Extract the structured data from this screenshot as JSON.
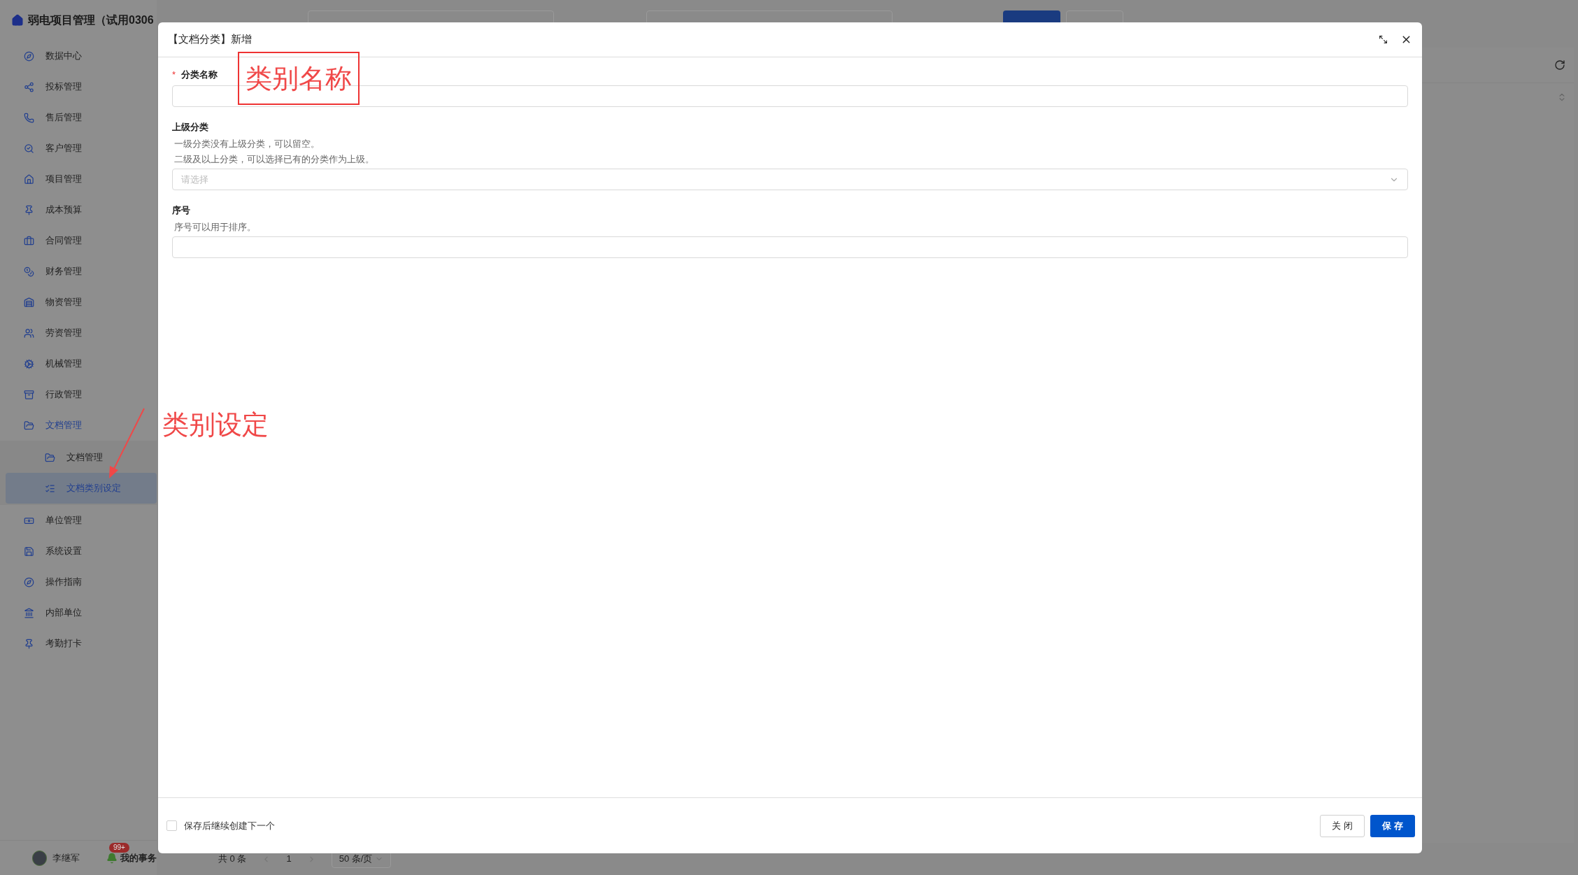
{
  "app_title": "弱电项目管理（试用0306",
  "sidebar": {
    "items": [
      {
        "label": "数据中心",
        "selected": false
      },
      {
        "label": "投标管理",
        "selected": false
      },
      {
        "label": "售后管理",
        "selected": false
      },
      {
        "label": "客户管理",
        "selected": false
      },
      {
        "label": "项目管理",
        "selected": false
      },
      {
        "label": "成本预算",
        "selected": false
      },
      {
        "label": "合同管理",
        "selected": false
      },
      {
        "label": "财务管理",
        "selected": false
      },
      {
        "label": "物资管理",
        "selected": false
      },
      {
        "label": "劳资管理",
        "selected": false
      },
      {
        "label": "机械管理",
        "selected": false
      },
      {
        "label": "行政管理",
        "selected": false
      },
      {
        "label": "文档管理",
        "selected": false,
        "expanded": true,
        "children": [
          {
            "label": "文档管理",
            "selected": false
          },
          {
            "label": "文档类别设定",
            "selected": true
          }
        ]
      },
      {
        "label": "单位管理",
        "selected": false
      },
      {
        "label": "系统设置",
        "selected": false
      },
      {
        "label": "操作指南",
        "selected": false
      },
      {
        "label": "内部单位",
        "selected": false
      },
      {
        "label": "考勤打卡",
        "selected": false
      }
    ]
  },
  "footer": {
    "user": "李继军",
    "tasks": "我的事务",
    "badge": "99+"
  },
  "pagination": {
    "total": "共 0 条",
    "page": "1",
    "page_size": "50 条/页"
  },
  "dialog": {
    "title": "【文档分类】新增",
    "fields": [
      {
        "kind": "input",
        "label": "分类名称",
        "required_mark": "*"
      },
      {
        "kind": "select",
        "label": "上级分类",
        "hints": [
          "一级分类没有上级分类，可以留空。",
          "二级及以上分类，可以选择已有的分类作为上级。"
        ],
        "placeholder": "请选择"
      },
      {
        "kind": "input",
        "label": "序号",
        "hints": [
          "序号可以用于排序。"
        ]
      }
    ],
    "continue_checkbox": {
      "label": "保存后继续创建下一个",
      "checked": false
    },
    "buttons": [
      {
        "kind": "default",
        "label": "关 闭"
      },
      {
        "kind": "primary",
        "label": "保 存"
      }
    ]
  },
  "annotations": [
    {
      "kind": "boxed",
      "text": "类别名称"
    },
    {
      "kind": "arrowed",
      "text": "类别设定"
    }
  ]
}
